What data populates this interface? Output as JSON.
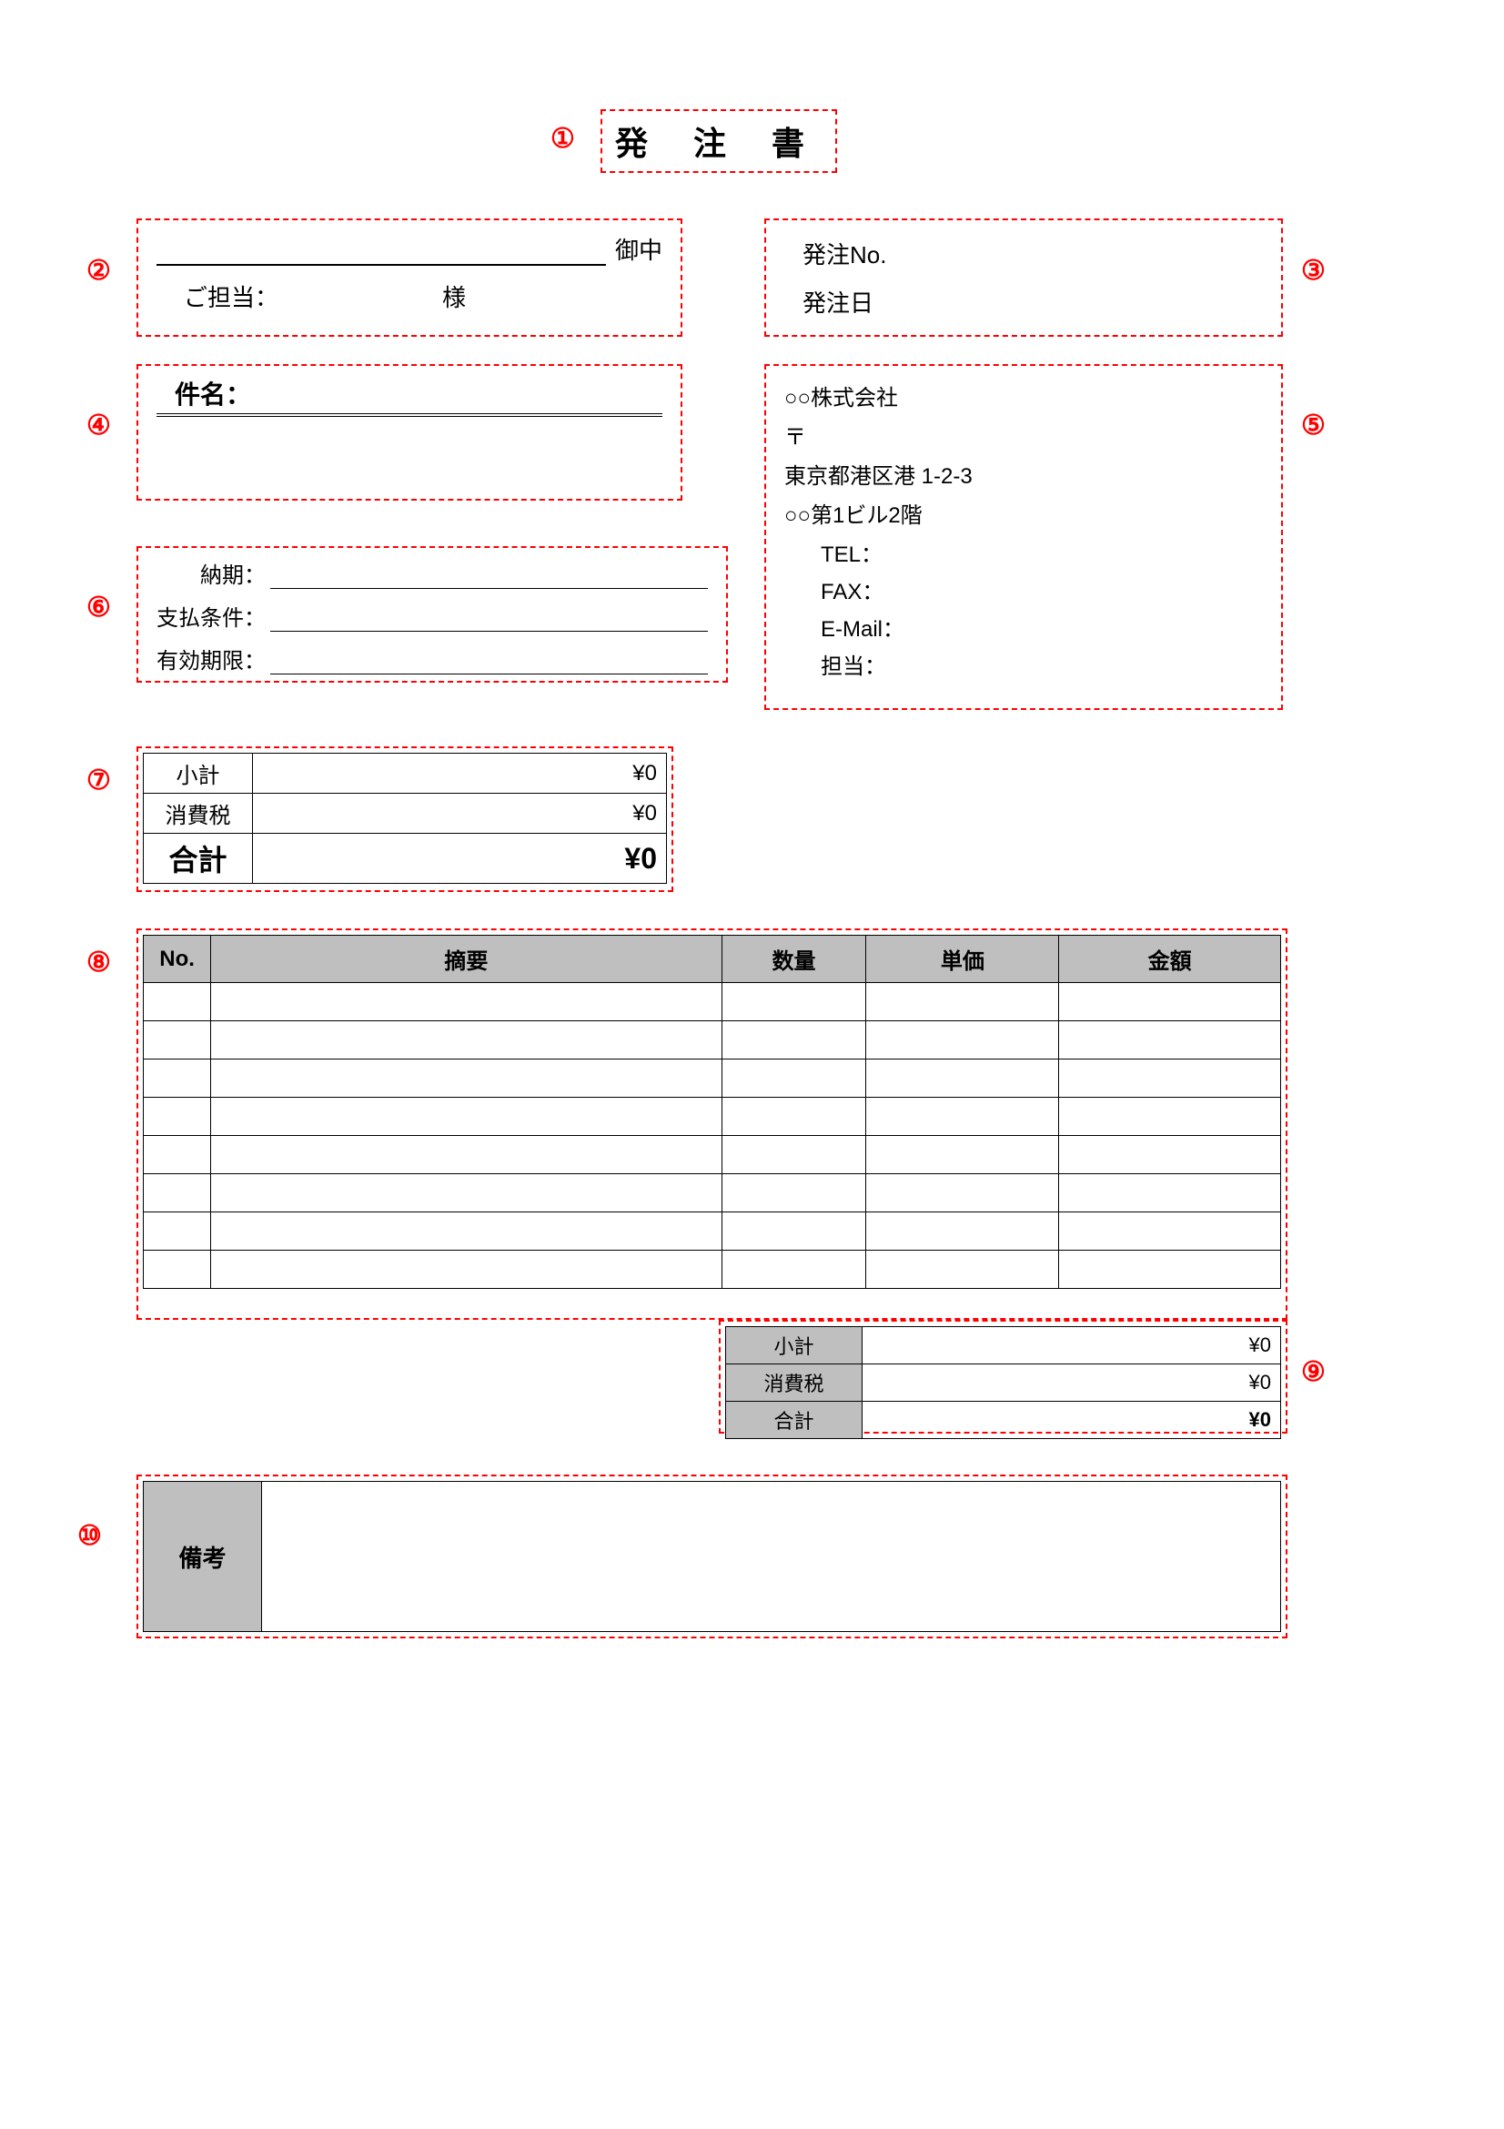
{
  "annotations": {
    "a1": "①",
    "a2": "②",
    "a3": "③",
    "a4": "④",
    "a5": "⑤",
    "a6": "⑥",
    "a7": "⑦",
    "a8": "⑧",
    "a9": "⑨",
    "a10": "⑩"
  },
  "title": "発 注 書",
  "recipient": {
    "suffix": "御中",
    "contact_label": "ご担当：",
    "contact_suffix": "様"
  },
  "order_info": {
    "no_label": "発注No.",
    "date_label": "発注日"
  },
  "subject": {
    "label": "件名："
  },
  "sender": {
    "company": "○○株式会社",
    "postal": "〒",
    "address1": "東京都港区港 1-2-3",
    "address2": "○○第1ビル2階",
    "tel_label": "TEL：",
    "fax_label": "FAX：",
    "email_label": "E-Mail：",
    "person_label": "担当："
  },
  "terms": {
    "delivery": "納期：",
    "payment": "支払条件：",
    "validity": "有効期限："
  },
  "summary": {
    "subtotal_label": "小計",
    "subtotal_value": "¥0",
    "tax_label": "消費税",
    "tax_value": "¥0",
    "total_label": "合計",
    "total_value": "¥0"
  },
  "items": {
    "headers": {
      "no": "No.",
      "desc": "摘要",
      "qty": "数量",
      "price": "単価",
      "amount": "金額"
    }
  },
  "items_subtotal": {
    "subtotal_label": "小計",
    "subtotal_value": "¥0",
    "tax_label": "消費税",
    "tax_value": "¥0",
    "total_label": "合計",
    "total_value": "¥0"
  },
  "remarks": {
    "label": "備考"
  }
}
